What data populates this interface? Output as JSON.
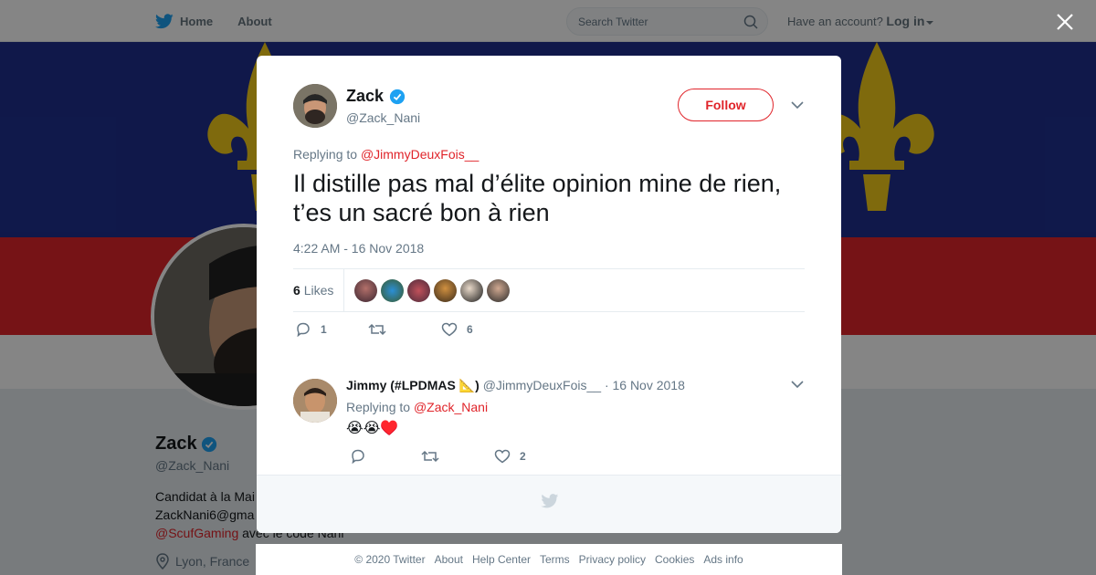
{
  "nav": {
    "home_label": "Home",
    "about_label": "About",
    "search_placeholder": "Search Twitter",
    "account_prompt": "Have an account?",
    "login_label": "Log in"
  },
  "background_profile": {
    "name": "Zack",
    "handle": "@Zack_Nani",
    "bio_line1": "Candidat à la Mai",
    "bio_line2": "ZackNani6@gma",
    "bio_link": "@ScufGaming",
    "bio_line3_rest": " avec le code Nani",
    "location": "Lyon, France"
  },
  "tweet": {
    "author_name": "Zack",
    "author_handle": "@Zack_Nani",
    "follow_label": "Follow",
    "replying_prefix": "Replying to ",
    "replying_to": "@JimmyDeuxFois__",
    "text": "Il distille pas mal d’élite opinion mine de rien, t’es un sacré bon à rien",
    "timestamp": "4:22 AM - 16 Nov 2018",
    "likes_count": "6",
    "likes_label": "Likes",
    "reply_count": "1",
    "retweet_count": "",
    "like_count": "6"
  },
  "reply": {
    "author_name": "Jimmy (#LPDMAS 📐)",
    "author_handle": "@JimmyDeuxFois__",
    "date": "· 16 Nov 2018",
    "replying_prefix": "Replying to ",
    "replying_to": "@Zack_Nani",
    "text": "😭😭♥️",
    "reply_count": "",
    "retweet_count": "",
    "like_count": "2"
  },
  "footer": {
    "links": [
      "© 2020 Twitter",
      "About",
      "Help Center",
      "Terms",
      "Privacy policy",
      "Cookies",
      "Ads info"
    ]
  },
  "colors": {
    "accent": "#e0242a",
    "twitter_blue": "#1da1f2",
    "verified": "#1da1f2",
    "banner_blue": "#1f2f8f",
    "banner_red": "#e3262b",
    "fleur_yellow": "#f4cc1a"
  }
}
